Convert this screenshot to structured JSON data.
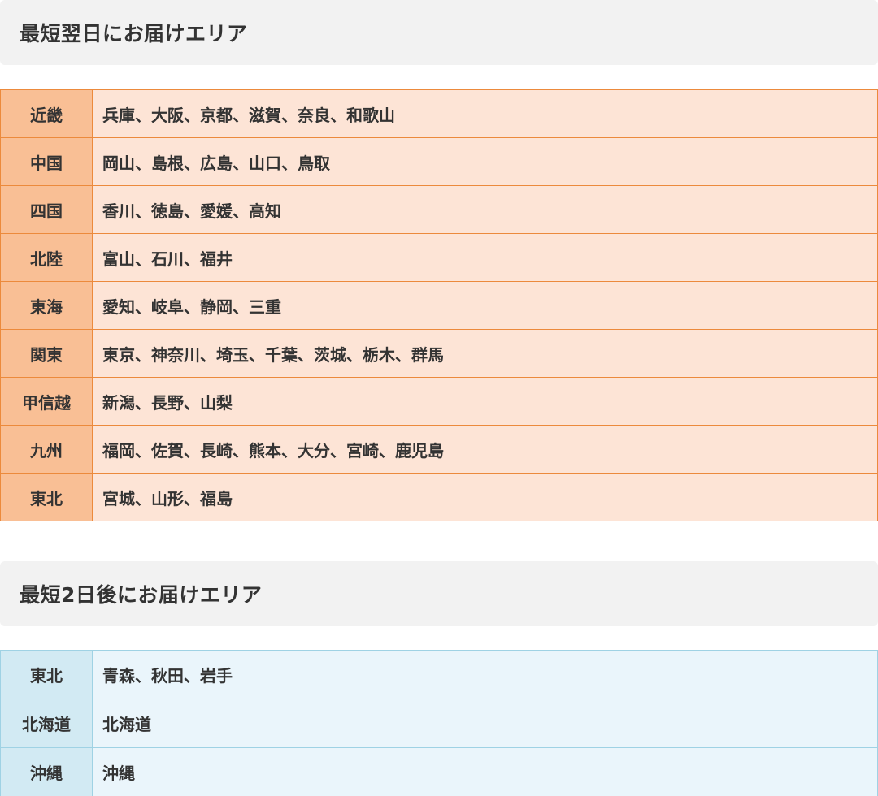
{
  "sections": [
    {
      "title": "最短翌日にお届けエリア",
      "rows": [
        {
          "region": "近畿",
          "prefectures": "兵庫、大阪、京都、滋賀、奈良、和歌山"
        },
        {
          "region": "中国",
          "prefectures": "岡山、島根、広島、山口、鳥取"
        },
        {
          "region": "四国",
          "prefectures": "香川、徳島、愛媛、高知"
        },
        {
          "region": "北陸",
          "prefectures": "富山、石川、福井"
        },
        {
          "region": "東海",
          "prefectures": "愛知、岐阜、静岡、三重"
        },
        {
          "region": "関東",
          "prefectures": "東京、神奈川、埼玉、千葉、茨城、栃木、群馬"
        },
        {
          "region": "甲信越",
          "prefectures": "新潟、長野、山梨"
        },
        {
          "region": "九州",
          "prefectures": "福岡、佐賀、長崎、熊本、大分、宮崎、鹿児島"
        },
        {
          "region": "東北",
          "prefectures": "宮城、山形、福島"
        }
      ]
    },
    {
      "title": "最短2日後にお届けエリア",
      "rows": [
        {
          "region": "東北",
          "prefectures": "青森、秋田、岩手"
        },
        {
          "region": "北海道",
          "prefectures": "北海道"
        },
        {
          "region": "沖縄",
          "prefectures": "沖縄"
        }
      ]
    }
  ],
  "colors": {
    "next_day_border": "#ec8a3c",
    "next_day_region_bg": "#f9bf95",
    "next_day_cell_bg": "#fde4d6",
    "two_day_border": "#9fd2e4",
    "two_day_region_bg": "#d2eaf3",
    "two_day_cell_bg": "#eaf5fb",
    "header_bg": "#f2f2f2"
  }
}
